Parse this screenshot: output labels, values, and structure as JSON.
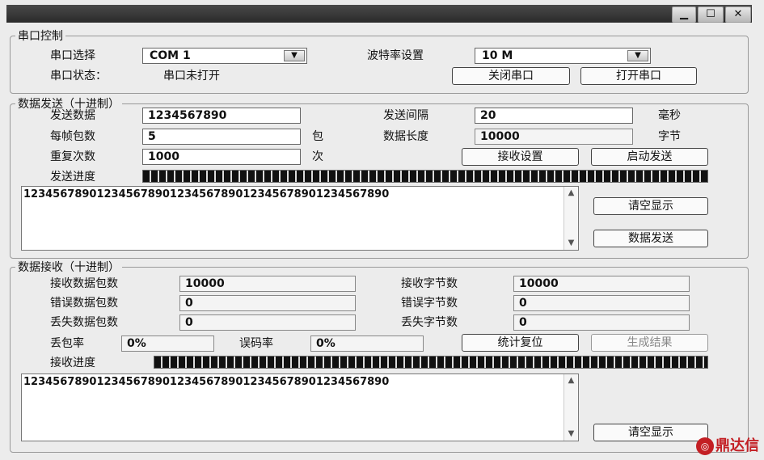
{
  "window": {
    "minimize_glyph": "▁",
    "maximize_glyph": "☐",
    "close_glyph": "✕"
  },
  "serial": {
    "title": "串口控制",
    "port_label": "串口选择",
    "port_value": "COM 1",
    "baud_label": "波特率设置",
    "baud_value": "10 M",
    "status_label": "串口状态：",
    "status_value": "串口未打开",
    "close_button": "关闭串口",
    "open_button": "打开串口"
  },
  "send": {
    "title": "数据发送（十进制）",
    "data_label": "发送数据",
    "data_value": "1234567890",
    "interval_label": "发送间隔",
    "interval_value": "20",
    "interval_unit": "毫秒",
    "packets_label": "每帧包数",
    "packets_value": "5",
    "packets_unit": "包",
    "length_label": "数据长度",
    "length_value": "10000",
    "length_unit": "字节",
    "repeat_label": "重复次数",
    "repeat_value": "1000",
    "repeat_unit": "次",
    "recv_settings_button": "接收设置",
    "start_button": "启动发送",
    "progress_label": "发送进度",
    "progress_value": 1.0,
    "display_text": "12345678901234567890123456789012345678901234567890",
    "clear_button": "请空显示",
    "send_button": "数据发送"
  },
  "receive": {
    "title": "数据接收（十进制）",
    "packets_label": "接收数据包数",
    "packets_value": "10000",
    "bytes_label": "接收字节数",
    "bytes_value": "10000",
    "err_packets_label": "错误数据包数",
    "err_packets_value": "0",
    "err_bytes_label": "错误字节数",
    "err_bytes_value": "0",
    "lost_packets_label": "丢失数据包数",
    "lost_packets_value": "0",
    "lost_bytes_label": "丢失字节数",
    "lost_bytes_value": "0",
    "loss_rate_label": "丢包率",
    "loss_rate_value": "0%",
    "ber_label": "误码率",
    "ber_value": "0%",
    "reset_button": "统计复位",
    "result_button": "生成结果",
    "progress_label": "接收进度",
    "progress_value": 1.0,
    "display_text": "12345678901234567890123456789012345678901234567890",
    "clear_button": "请空显示"
  },
  "watermark": {
    "text": "鼎达信"
  }
}
